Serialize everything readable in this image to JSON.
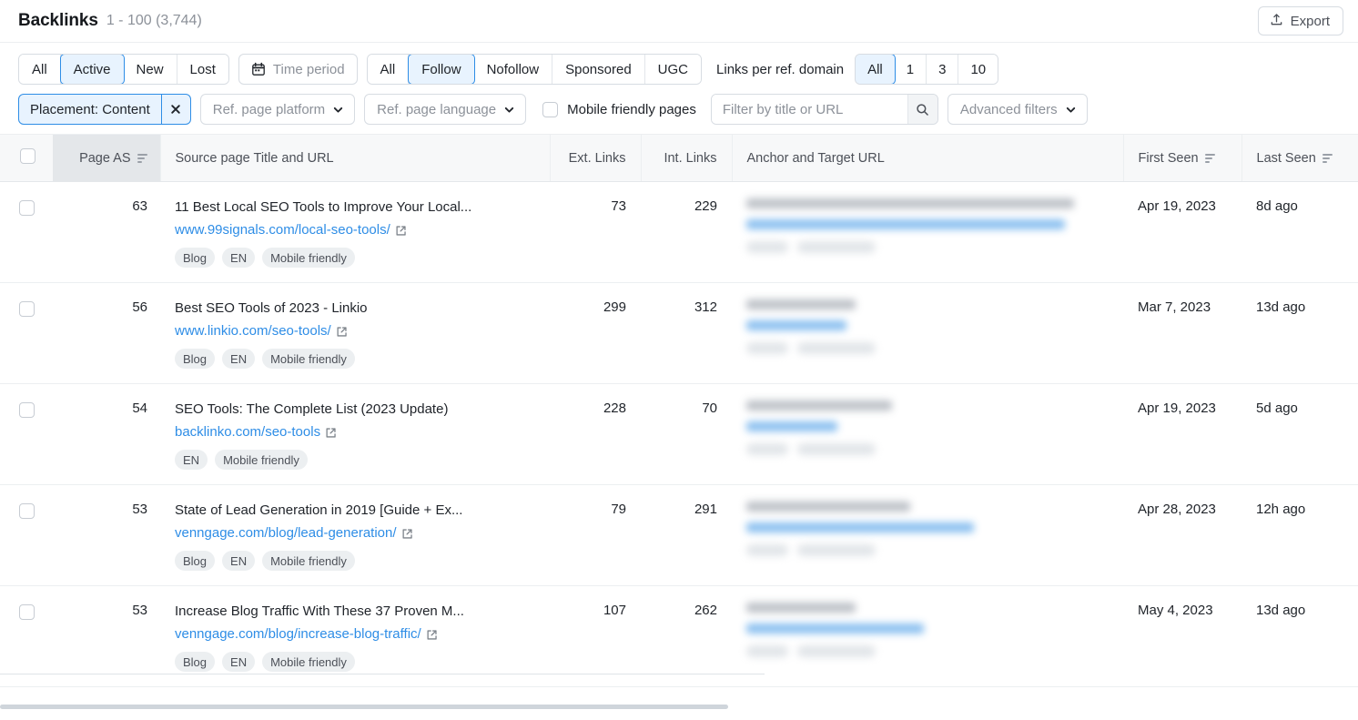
{
  "header": {
    "title": "Backlinks",
    "range": "1 - 100 (3,744)",
    "export_label": "Export",
    "export_icon": "upload-icon"
  },
  "filters": {
    "status_segment": {
      "name": "link-status",
      "options": [
        "All",
        "Active",
        "New",
        "Lost"
      ],
      "selected": "Active"
    },
    "time_period": {
      "label": "Time period",
      "icon": "calendar-icon"
    },
    "follow_segment": {
      "name": "follow-type",
      "options": [
        "All",
        "Follow",
        "Nofollow",
        "Sponsored",
        "UGC"
      ],
      "selected": "Follow"
    },
    "links_per_domain": {
      "label": "Links per ref. domain",
      "options": [
        "All",
        "1",
        "3",
        "10"
      ],
      "selected": "All"
    },
    "placement_tag": {
      "label": "Placement: Content",
      "remove_icon": "close-icon"
    },
    "ref_page_platform": {
      "label": "Ref. page platform",
      "icon": "chevron-down-icon"
    },
    "ref_page_language": {
      "label": "Ref. page language",
      "icon": "chevron-down-icon"
    },
    "mobile_friendly": {
      "label": "Mobile friendly pages",
      "checked": false
    },
    "search": {
      "placeholder": "Filter by title or URL",
      "value": "",
      "icon": "search-icon"
    },
    "advanced_filters": {
      "label": "Advanced filters",
      "icon": "chevron-down-icon"
    }
  },
  "table": {
    "columns": {
      "page_as": "Page AS",
      "source": "Source page Title and URL",
      "ext_links": "Ext. Links",
      "int_links": "Int. Links",
      "anchor": "Anchor and Target URL",
      "first_seen": "First Seen",
      "last_seen": "Last Seen"
    },
    "rows": [
      {
        "page_as": "63",
        "title": "11 Best Local SEO Tools to Improve Your Local...",
        "url": "www.99signals.com/local-seo-tools/",
        "badges": [
          "Blog",
          "EN",
          "Mobile friendly"
        ],
        "ext_links": "73",
        "int_links": "229",
        "anchor_hidden": true,
        "first_seen": "Apr 19, 2023",
        "last_seen": "8d ago"
      },
      {
        "page_as": "56",
        "title": "Best SEO Tools of 2023 - Linkio",
        "url": "www.linkio.com/seo-tools/",
        "badges": [
          "Blog",
          "EN",
          "Mobile friendly"
        ],
        "ext_links": "299",
        "int_links": "312",
        "anchor_hidden": true,
        "first_seen": "Mar 7, 2023",
        "last_seen": "13d ago"
      },
      {
        "page_as": "54",
        "title": "SEO Tools: The Complete List (2023 Update)",
        "url": "backlinko.com/seo-tools",
        "badges": [
          "EN",
          "Mobile friendly"
        ],
        "ext_links": "228",
        "int_links": "70",
        "anchor_hidden": true,
        "first_seen": "Apr 19, 2023",
        "last_seen": "5d ago"
      },
      {
        "page_as": "53",
        "title": "State of Lead Generation in 2019 [Guide + Ex...",
        "url": "venngage.com/blog/lead-generation/",
        "badges": [
          "Blog",
          "EN",
          "Mobile friendly"
        ],
        "ext_links": "79",
        "int_links": "291",
        "anchor_hidden": true,
        "first_seen": "Apr 28, 2023",
        "last_seen": "12h ago"
      },
      {
        "page_as": "53",
        "title": "Increase Blog Traffic With These 37 Proven M...",
        "url": "venngage.com/blog/increase-blog-traffic/",
        "badges": [
          "Blog",
          "EN",
          "Mobile friendly"
        ],
        "ext_links": "107",
        "int_links": "262",
        "anchor_hidden": true,
        "first_seen": "May 4, 2023",
        "last_seen": "13d ago"
      }
    ]
  },
  "colors": {
    "accent": "#2e8de6",
    "accent_bg": "#e8f3fe",
    "text": "#21252b",
    "muted": "#8c9199",
    "badge_bg": "#eceff1"
  }
}
